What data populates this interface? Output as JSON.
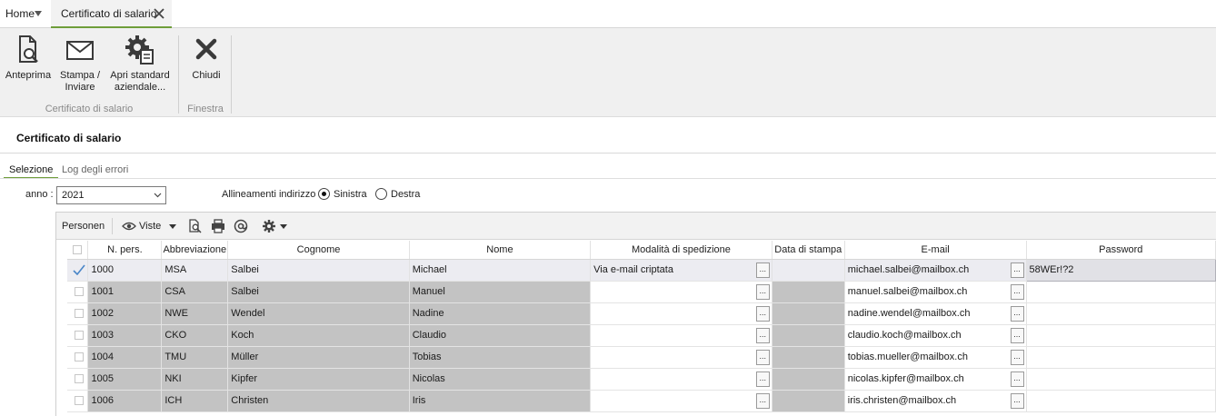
{
  "tabs": {
    "home": "Home",
    "active": "Certificato di salario"
  },
  "ribbon": {
    "preview": "Anteprima",
    "print_send_1": "Stampa /",
    "print_send_2": "Inviare",
    "open_std_1": "Apri standard",
    "open_std_2": "aziendale...",
    "close": "Chiudi",
    "group1": "Certificato di salario",
    "group2": "Finestra"
  },
  "page": {
    "title": "Certificato di salario"
  },
  "subtabs": {
    "selection": "Selezione",
    "errors": "Log degli errori"
  },
  "filters": {
    "year_label": "anno :",
    "year_value": "2021",
    "alignment_label": "Allineamenti indirizzo :",
    "left": "Sinistra",
    "right": "Destra",
    "selected": "left"
  },
  "grid_toolbar": {
    "title": "Personen",
    "views": "Viste"
  },
  "columns": [
    "N. pers.",
    "Abbreviazione",
    "Cognome",
    "Nome",
    "Modalità di spedizione",
    "Data di stampa",
    "E-mail",
    "Password"
  ],
  "rows": [
    {
      "num": "1000",
      "abbr": "MSA",
      "last": "Salbei",
      "first": "Michael",
      "mode": "Via e-mail criptata",
      "date": "",
      "email": "michael.salbei@mailbox.ch",
      "password": "58WEr!?2",
      "checked": true
    },
    {
      "num": "1001",
      "abbr": "CSA",
      "last": "Salbei",
      "first": "Manuel",
      "mode": "",
      "date": "",
      "email": "manuel.salbei@mailbox.ch",
      "password": "",
      "checked": false
    },
    {
      "num": "1002",
      "abbr": "NWE",
      "last": "Wendel",
      "first": "Nadine",
      "mode": "",
      "date": "",
      "email": "nadine.wendel@mailbox.ch",
      "password": "",
      "checked": false
    },
    {
      "num": "1003",
      "abbr": "CKO",
      "last": "Koch",
      "first": "Claudio",
      "mode": "",
      "date": "",
      "email": "claudio.koch@mailbox.ch",
      "password": "",
      "checked": false
    },
    {
      "num": "1004",
      "abbr": "TMU",
      "last": "Müller",
      "first": "Tobias",
      "mode": "",
      "date": "",
      "email": "tobias.mueller@mailbox.ch",
      "password": "",
      "checked": false
    },
    {
      "num": "1005",
      "abbr": "NKI",
      "last": "Kipfer",
      "first": "Nicolas",
      "mode": "",
      "date": "",
      "email": "nicolas.kipfer@mailbox.ch",
      "password": "",
      "checked": false
    },
    {
      "num": "1006",
      "abbr": "ICH",
      "last": "Christen",
      "first": "Iris",
      "mode": "",
      "date": "",
      "email": "iris.christen@mailbox.ch",
      "password": "",
      "checked": false
    }
  ],
  "ellipsis": "...",
  "colors": {
    "accent": "#6f9e3a",
    "gray_cell": "#c3c3c3",
    "selected_row": "#ececf1"
  }
}
